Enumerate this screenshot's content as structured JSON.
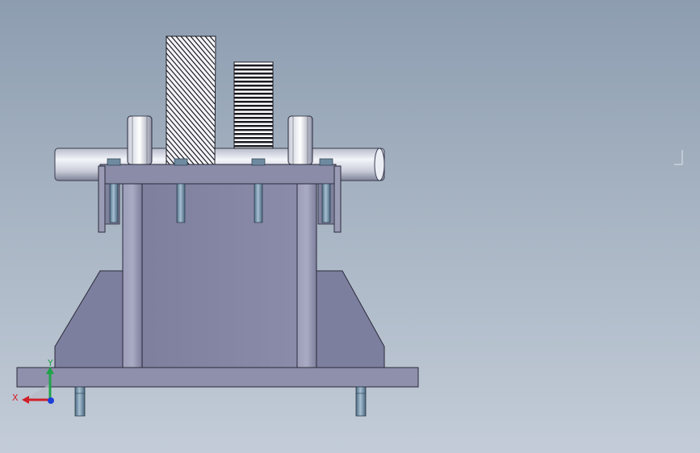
{
  "viewport": {
    "background_top": "#8d9db0",
    "background_bottom": "#c3ccd8"
  },
  "triad": {
    "x_label": "X",
    "y_label": "Y",
    "x_color": "#d0202a",
    "y_color": "#1fa34a",
    "z_color": "#1d3fd6"
  },
  "model": {
    "body_color": "#8a8ca8",
    "shaft_color": "#d8dbe6",
    "bolt_color": "#6f8fa8"
  }
}
